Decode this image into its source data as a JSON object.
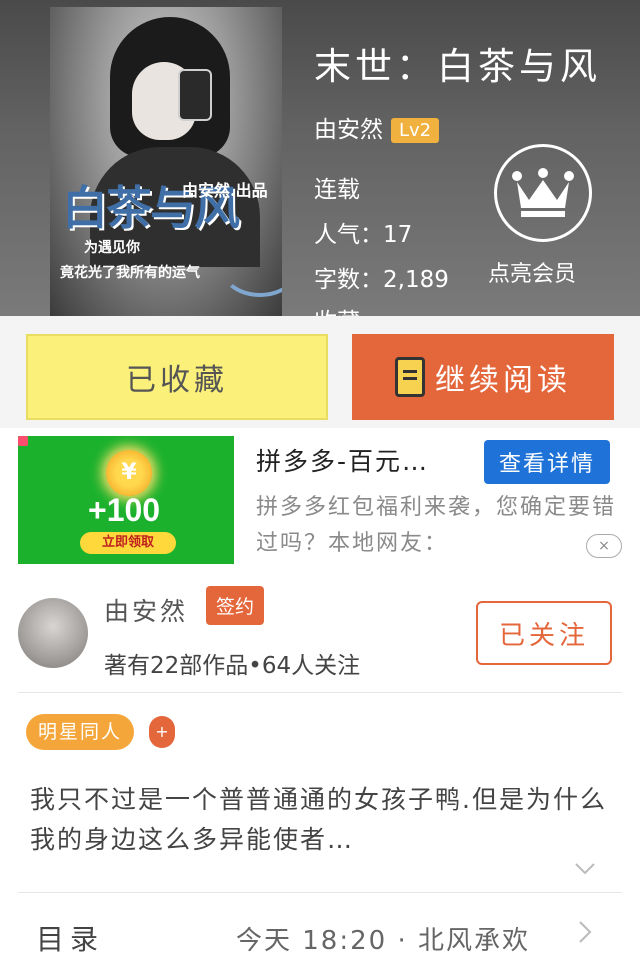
{
  "book": {
    "title": "末世：白茶与风",
    "author": "由安然",
    "level": "Lv2",
    "status": "连载",
    "popularity": "人气：17",
    "word_count": "字数：2,189",
    "partial_line": "收藏"
  },
  "cover": {
    "title_art": "白茶与风",
    "author_tag": "由安然.出品",
    "tagline1": "为遇见你",
    "tagline2": "竟花光了我所有的运气"
  },
  "vip": {
    "label": "点亮会员",
    "icon": "crown-icon"
  },
  "actions": {
    "favorite_label": "已收藏",
    "read_label": "继续阅读"
  },
  "ad": {
    "coin_symbol": "¥",
    "amount": "+100",
    "claim_label": "立即领取",
    "title": "拼多多-百元…",
    "detail_label": "查看详情",
    "description": "拼多多红包福利来袭，您确定要错过吗？本地网友：",
    "close_icon": "×"
  },
  "author_section": {
    "name": "由安然",
    "sign_badge": "签约",
    "stats": "著有22部作品•64人关注",
    "follow_label": "已关注"
  },
  "tags": {
    "genre": "明星同人",
    "add": "+"
  },
  "intro": "我只不过是一个普普通通的女孩子鸭.但是为什么我的身边这么多异能使者…",
  "toc": {
    "label": "目录",
    "latest": "今天 18:20 · 北风承欢"
  },
  "colors": {
    "accent_orange": "#e4663b",
    "favorite_yellow": "#fbf07a",
    "badge_gold": "#f0b13f",
    "ad_blue": "#1f72d7",
    "ad_green": "#1bb12d"
  }
}
